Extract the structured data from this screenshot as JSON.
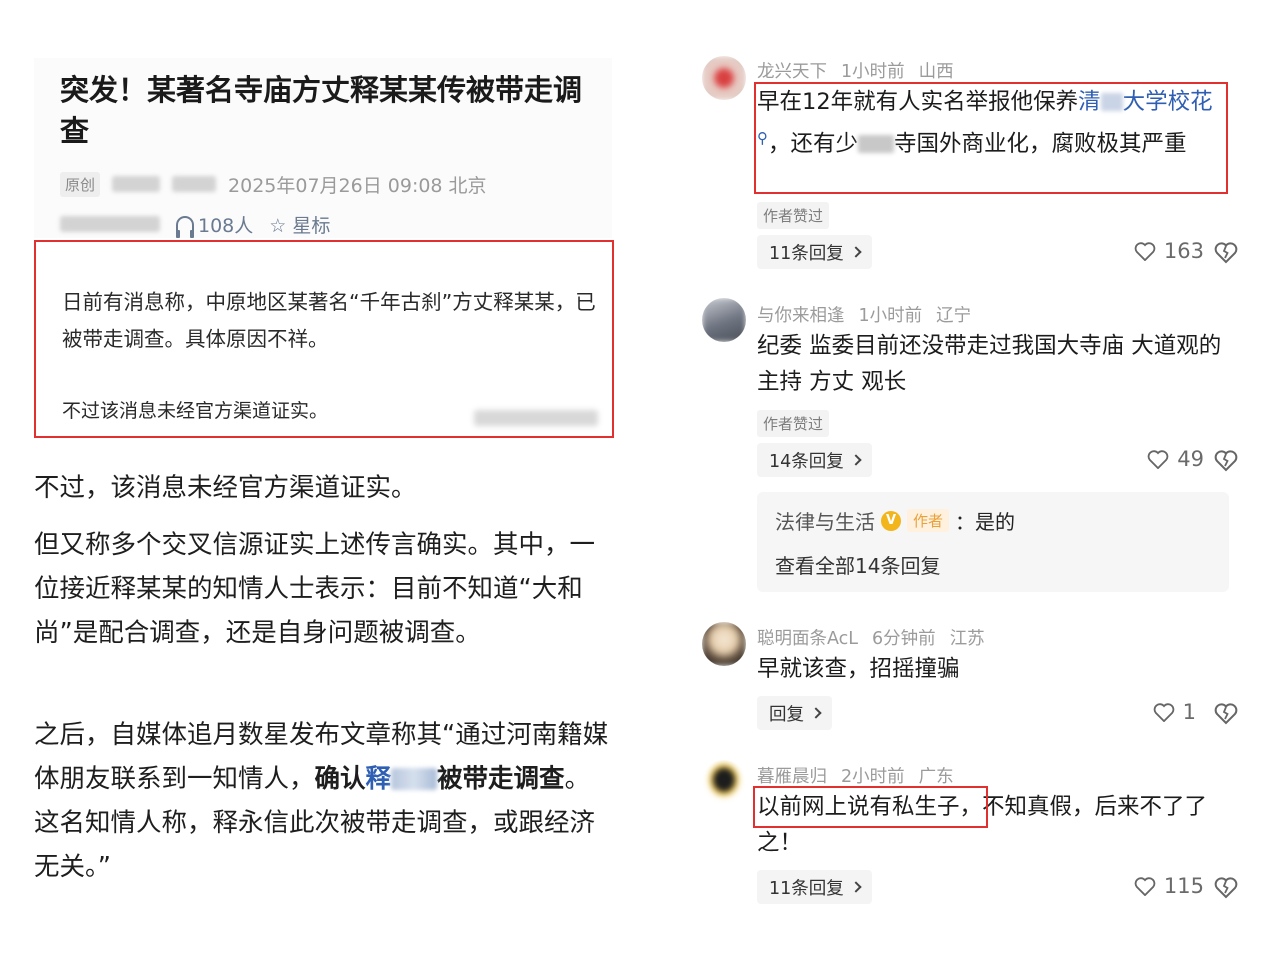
{
  "article": {
    "title": "突发！某著名寺庙方丈释某某传被带走调查",
    "original_badge": "原创",
    "date_location": "2025年07月26日 09:08 北京",
    "listeners": "108人",
    "star_label": "☆ 星标"
  },
  "quote": {
    "p1": "日前有消息称，中原地区某著名“千年古刹”方丈释某某，已被带走调查。具体原因不祥。",
    "p2": "不过该消息未经官方渠道证实。"
  },
  "body": {
    "p1": "不过，该消息未经官方渠道证实。",
    "p2": "但又称多个交叉信源证实上述传言确实。其中，一位接近释某某的知情人士表示：目前不知道“大和尚”是配合调查，还是自身问题被调查。",
    "p3_a": "之后，自媒体追月数星发布文章称其“通过河南籍媒体朋友联系到一知情人，",
    "p3_b": "确认",
    "p3_c": "释",
    "p3_d": "被带走调查",
    "p3_e": "。这名知情人称，释永信此次被带走调查，或跟经济无关。”"
  },
  "comments": [
    {
      "user": "龙兴天下",
      "time": "1小时前",
      "region": "山西",
      "text_a": "早在12年就有人实名举报他保养",
      "link_a": "清",
      "link_b": "大学校花",
      "text_b": "，还有少",
      "text_c": "寺国外商业化，腐败极其严重",
      "author_liked": "作者赞过",
      "replies": "11条回复",
      "likes": "163"
    },
    {
      "user": "与你来相逢",
      "time": "1小时前",
      "region": "辽宁",
      "text": "纪委 监委目前还没带走过我国大寺庙 大道观的 主持 方丈 观长",
      "author_liked": "作者赞过",
      "replies": "14条回复",
      "likes": "49",
      "sub_reply": {
        "user": "法律与生活",
        "verified": "V",
        "tag": "作者",
        "text": "：是的",
        "view_all": "查看全部14条回复"
      }
    },
    {
      "user": "聪明面条AcL",
      "time": "6分钟前",
      "region": "江苏",
      "text": "早就该查，招摇撞骗",
      "replies": "回复",
      "likes": "1"
    },
    {
      "user": "暮雁晨归",
      "time": "2小时前",
      "region": "广东",
      "text_a": "以前网上说有私生子，",
      "text_b": "不知真假，后来不了了之！",
      "replies": "11条回复",
      "likes": "115"
    }
  ],
  "icons": {
    "headphone": "headphone-icon",
    "star": "star-icon",
    "heart": "heart-icon",
    "dislike": "broken-heart-icon",
    "chevron": "chevron-right-icon",
    "verified": "verified-v-icon",
    "search": "search-icon"
  },
  "colors": {
    "highlight_border": "#e03030",
    "link_blue": "#2f5fb3",
    "meta_grey": "#9b9b9b",
    "author_tag": "#e9a13b"
  }
}
